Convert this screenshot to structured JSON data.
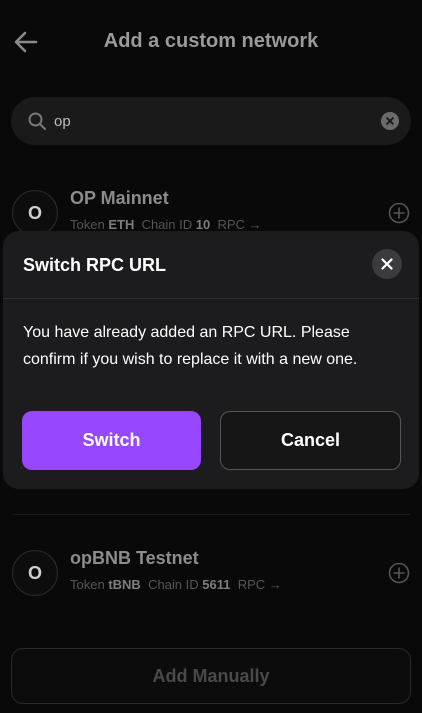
{
  "header": {
    "title": "Add a custom network"
  },
  "search": {
    "value": "op"
  },
  "networks": [
    {
      "avatar": "O",
      "name": "OP Mainnet",
      "token_label": "Token",
      "token": "ETH",
      "chain_label": "Chain ID",
      "chain_id": "10",
      "rpc_label": "RPC"
    },
    {
      "avatar": "O",
      "name": "opBNB Testnet",
      "token_label": "Token",
      "token": "tBNB",
      "chain_label": "Chain ID",
      "chain_id": "5611",
      "rpc_label": "RPC"
    }
  ],
  "footer": {
    "add_manually": "Add Manually"
  },
  "modal": {
    "title": "Switch RPC URL",
    "message": "You have already added an RPC URL. Please confirm if you wish to replace it with a new one.",
    "switch_label": "Switch",
    "cancel_label": "Cancel"
  },
  "colors": {
    "accent": "#9747ff",
    "background": "#090909",
    "modal": "#1c1c1e"
  }
}
